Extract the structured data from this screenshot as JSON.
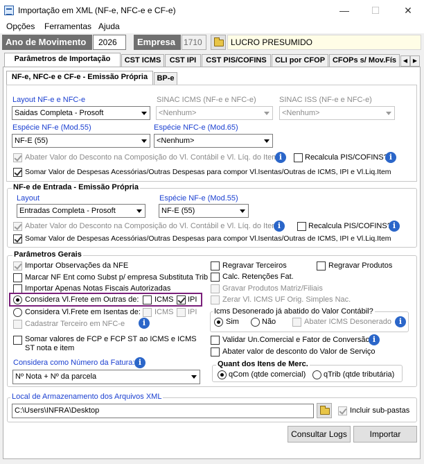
{
  "window": {
    "title": "Importação em XML (NF-e, NFC-e e CF-e)",
    "minimize": "—",
    "maximize": "☐",
    "close": "✕"
  },
  "menu": [
    "Opções",
    "Ferramentas",
    "Ajuda"
  ],
  "header": {
    "ano_label": "Ano de Movimento",
    "ano_value": "2026",
    "empresa_label": "Empresa",
    "empresa_code": "1710",
    "empresa_name": "LUCRO PRESUMIDO"
  },
  "tabs": [
    "Parâmetros de Importação",
    "CST ICMS",
    "CST IPI",
    "CST PIS/COFINS",
    "CLI por CFOP",
    "CFOPs s/ Mov.Fís"
  ],
  "subtabs": [
    "NF-e, NFC-e e CF-e - Emissão Própria",
    "BP-e"
  ],
  "emissao": {
    "layout_label": "Layout NF-e e NFC-e",
    "layout_value": "Saidas Completa - Prosoft",
    "sinac_icms_label": "SINAC ICMS (NF-e e NFC-e)",
    "sinac_icms_value": "<Nenhum>",
    "sinac_iss_label": "SINAC ISS (NF-e e NFC-e)",
    "sinac_iss_value": "<Nenhum>",
    "especie_nfe_label": "Espécie NF-e (Mod.55)",
    "especie_nfe_value": "NF-E (55)",
    "especie_nfce_label": "Espécie NFC-e (Mod.65)",
    "especie_nfce_value": "<Nenhum>",
    "abater_label": "Abater Valor do Desconto na Composição do Vl. Contábil e Vl. Líq. do Item",
    "recalcula_label": "Recalcula PIS/COFINS?",
    "somar_label": "Somar Valor de Despesas Acessórias/Outras Despesas para compor Vl.Isentas/Outras de ICMS, IPI e Vl.Liq.Item"
  },
  "entrada": {
    "title": "NF-e de Entrada - Emissão Própria",
    "layout_label": "Layout",
    "layout_value": "Entradas Completa - Prosoft",
    "especie_label": "Espécie NF-e (Mod.55)",
    "especie_value": "NF-E (55)",
    "abater_label": "Abater Valor do Desconto na Composição do Vl. Contábil e Vl. Líq. do Item",
    "recalcula_label": "Recalcula PIS/COFINS?",
    "somar_label": "Somar Valor de Despesas Acessórias/Outras Despesas para compor Vl.Isentas/Outras de ICMS, IPI e Vl.Liq.Item"
  },
  "gerais": {
    "title": "Parâmetros Gerais",
    "importar_obs": "Importar Observações da NFE",
    "marcar_nf": "Marcar NF Ent como Subst p/ empresa Substituta Trib",
    "importar_aut": "Importar Apenas Notas Fiscais Autorizadas",
    "frete_outras": "Considera Vl.Frete em Outras de:",
    "frete_isentas": "Considera Vl.Frete em Isentas de:",
    "icms": "ICMS",
    "ipi": "IPI",
    "cadastrar": "Cadastrar Terceiro em NFC-e",
    "somar_fcp": "Somar valores de FCP e FCP ST ao ICMS e ICMS ST nota e item",
    "fatura_label": "Considera como Número da Fatura:",
    "fatura_value": "Nº Nota + Nº da parcela",
    "regravar_terc": "Regravar Terceiros",
    "regravar_prod": "Regravar Produtos",
    "calc_ret": "Calc. Retenções Fat.",
    "gravar_prod": "Gravar Produtos Matriz/Filiais",
    "zerar": "Zerar Vl. ICMS UF Orig. Simples Nac.",
    "deson_title": "Icms Desonerado já abatido do Valor Contábil?",
    "sim": "Sim",
    "nao": "Não",
    "abater_deson": "Abater ICMS Desonerado",
    "validar": "Validar Un.Comercial e Fator de Conversão",
    "abater_serv": "Abater valor de desconto do Valor de Serviço",
    "quant_title": "Quant dos Itens de Merc.",
    "qcom": "qCom (qtde comercial)",
    "qtrib": "qTrib (qtde tributária)"
  },
  "local": {
    "label": "Local de Armazenamento dos Arquivos XML",
    "path": "C:\\Users\\INFRA\\Desktop",
    "subpastas": "Incluir sub-pastas"
  },
  "buttons": {
    "logs": "Consultar Logs",
    "importar": "Importar"
  }
}
